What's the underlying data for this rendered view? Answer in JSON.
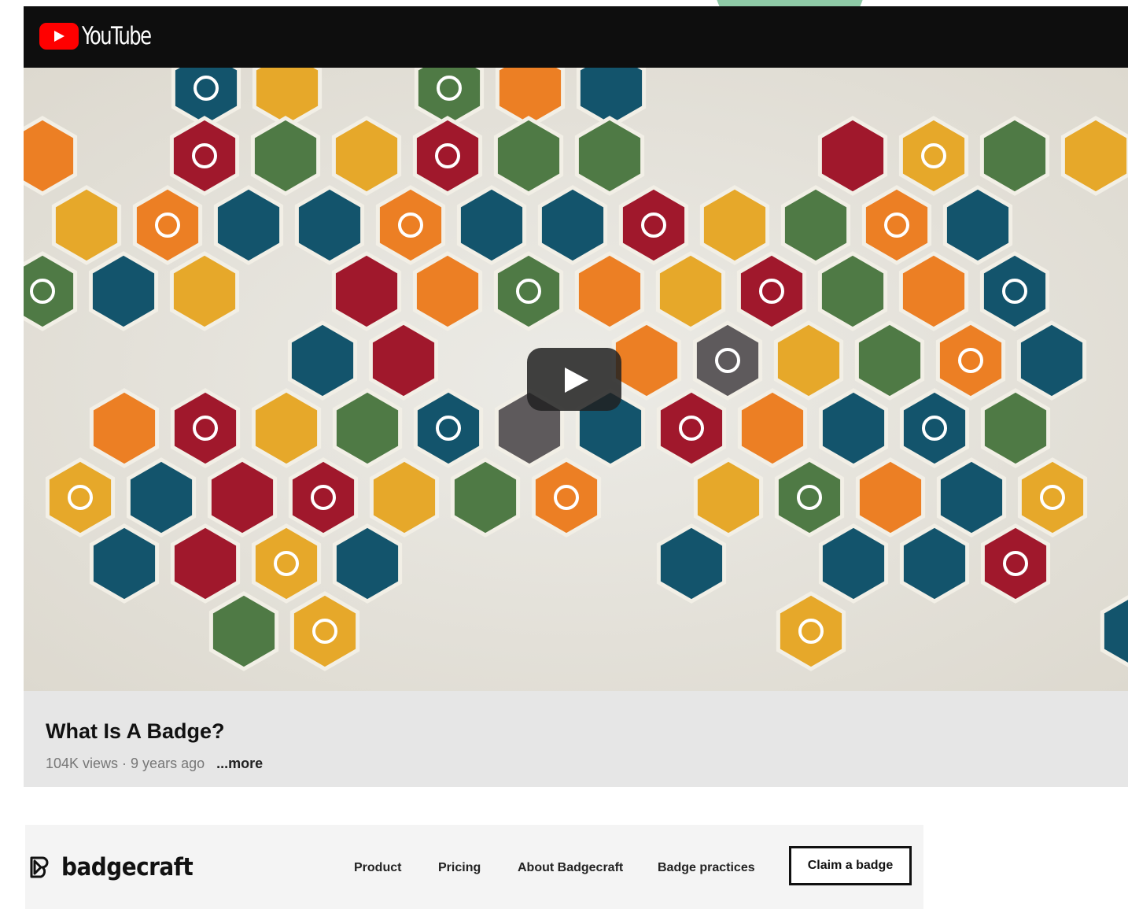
{
  "youtube": {
    "brand": "YouTube",
    "video": {
      "title": "What Is A Badge?",
      "stats": "104K views · 9 years ago",
      "more_label": "...more"
    },
    "icon": "youtube-logo-icon",
    "play_icon": "play-icon",
    "colors": {
      "bar": "#0e0e0e",
      "logo_red": "#ff0000",
      "hex_red": "#a0182c",
      "hex_orange": "#ec7f24",
      "hex_yellow": "#e6a82a",
      "hex_teal": "#13546c",
      "hex_green": "#4f7a45",
      "hex_gray": "#5e5a5c"
    }
  },
  "badgecraft": {
    "brand": "badgecraft",
    "logo_icon": "badgecraft-logo-icon",
    "nav": {
      "product": "Product",
      "pricing": "Pricing",
      "about": "About Badgecraft",
      "practices": "Badge practices",
      "claim": "Claim a badge"
    }
  },
  "decoration": {
    "accent": "#8ec9a6"
  }
}
